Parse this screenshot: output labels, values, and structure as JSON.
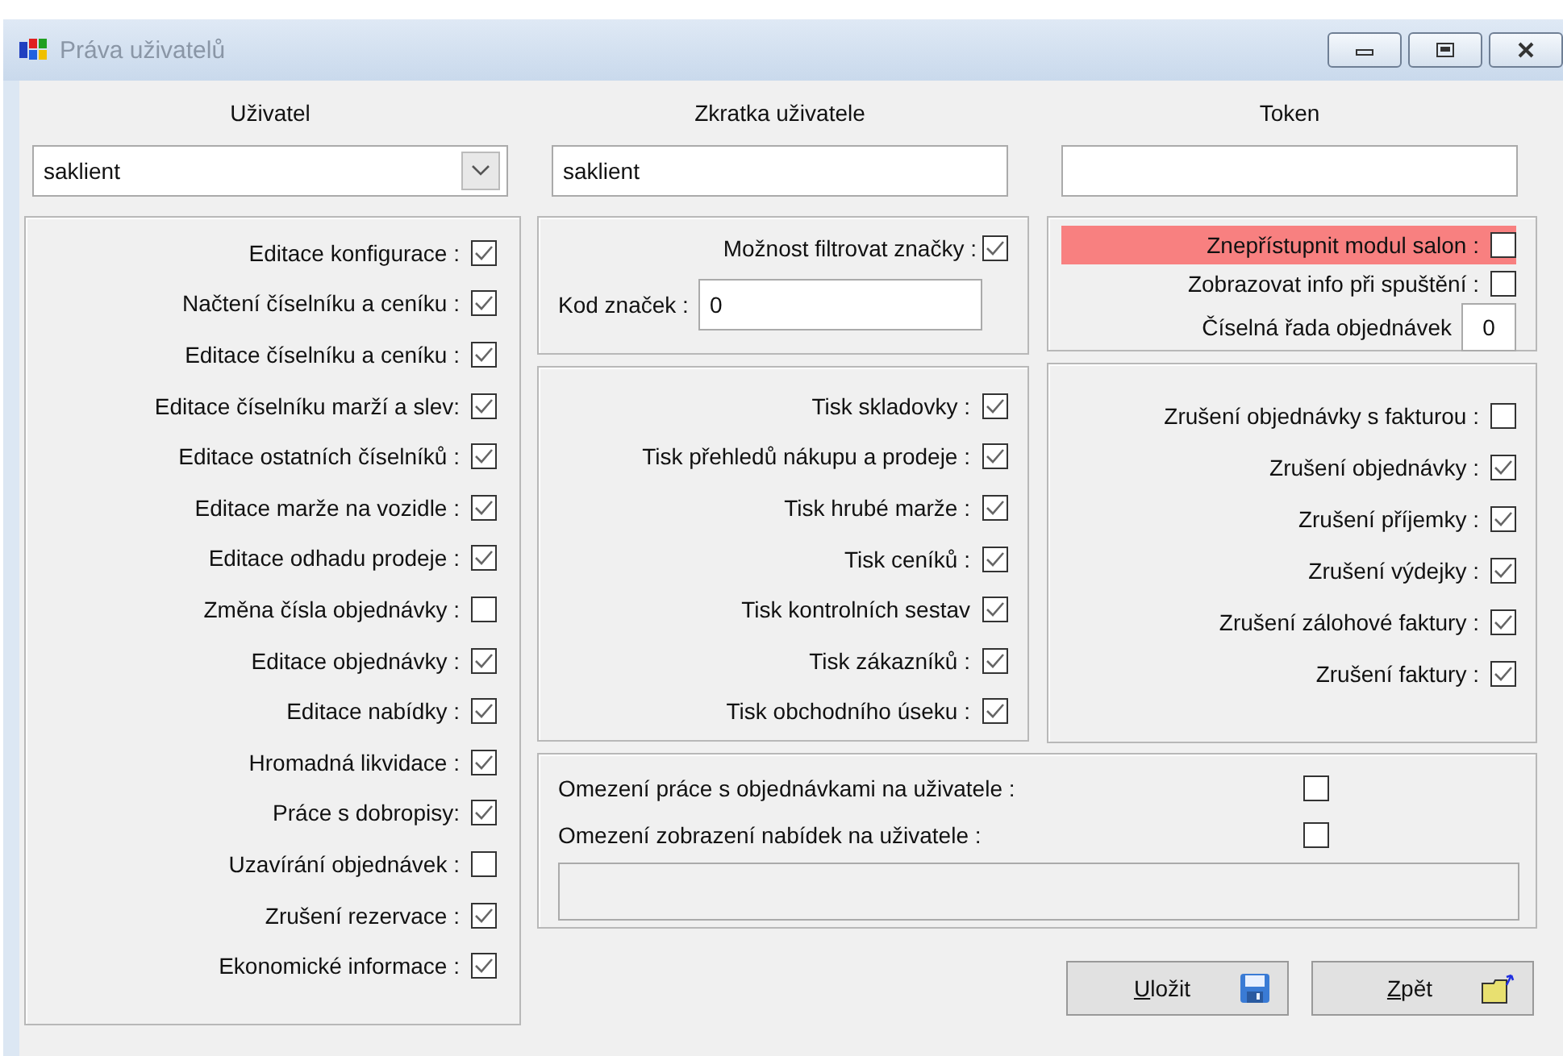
{
  "window": {
    "title": "Práva uživatelů"
  },
  "fields": [
    {
      "label": "Uživatel",
      "value": "saklient",
      "kind": "combo"
    },
    {
      "label": "Zkratka uživatele",
      "value": "saklient",
      "kind": "text"
    },
    {
      "label": "Token",
      "kind": "text"
    }
  ],
  "user_permissions": [
    {
      "label": "Editace konfigurace :",
      "checked": true
    },
    {
      "label": "Načtení číselníku a ceníku :",
      "checked": true
    },
    {
      "label": "Editace číselníku a ceníku :",
      "checked": true
    },
    {
      "label": "Editace číselníku marží a slev:",
      "checked": true
    },
    {
      "label": "Editace ostatních číselníků :",
      "checked": true
    },
    {
      "label": "Editace marže na vozidle :",
      "checked": true
    },
    {
      "label": "Editace odhadu prodeje :",
      "checked": true
    },
    {
      "label": "Změna čísla objednávky :",
      "checked": false
    },
    {
      "label": "Editace objednávky :",
      "checked": true
    },
    {
      "label": "Editace nabídky :",
      "checked": true
    },
    {
      "label": "Hromadná likvidace :",
      "checked": true
    },
    {
      "label": "Práce s dobropisy:",
      "checked": true
    },
    {
      "label": "Uzavírání objednávek :",
      "checked": false
    },
    {
      "label": "Zrušení rezervace :",
      "checked": true
    },
    {
      "label": "Ekonomické informace :",
      "checked": true
    }
  ],
  "filter_brands": {
    "label": "Možnost filtrovat značky :",
    "checked": true
  },
  "brand_code": {
    "label": "Kod značek :",
    "value": "0"
  },
  "print_permissions": [
    {
      "label": "Tisk skladovky :",
      "checked": true
    },
    {
      "label": "Tisk přehledů nákupu a prodeje :",
      "checked": true
    },
    {
      "label": "Tisk hrubé marže :",
      "checked": true
    },
    {
      "label": "Tisk ceníků :",
      "checked": true
    },
    {
      "label": "Tisk kontrolních sestav",
      "checked": true
    },
    {
      "label": "Tisk zákazníků :",
      "checked": true
    },
    {
      "label": "Tisk obchodního úseku :",
      "checked": true
    }
  ],
  "salon_options": [
    {
      "label": "Znepřístupnit modul salon :",
      "checked": false,
      "highlighted": true
    },
    {
      "label": "Zobrazovat info při spuštění :",
      "checked": false,
      "highlighted": false
    }
  ],
  "order_series": {
    "label": "Číselná řada objednávek",
    "value": "0"
  },
  "cancel_permissions": [
    {
      "label": "Zrušení objednávky s fakturou :",
      "checked": false
    },
    {
      "label": "Zrušení objednávky :",
      "checked": true
    },
    {
      "label": "Zrušení příjemky :",
      "checked": true
    },
    {
      "label": "Zrušení výdejky :",
      "checked": true
    },
    {
      "label": "Zrušení zálohové faktury :",
      "checked": true
    },
    {
      "label": "Zrušení faktury :",
      "checked": true
    }
  ],
  "restrictions": [
    {
      "label": "Omezení práce s objednávkami na uživatele :",
      "checked": false
    },
    {
      "label": "Omezení zobrazení nabídek na uživatele :",
      "checked": false
    }
  ],
  "buttons": [
    {
      "label": "Uložit",
      "kind": "save"
    },
    {
      "label": "Zpět",
      "kind": "back"
    }
  ]
}
